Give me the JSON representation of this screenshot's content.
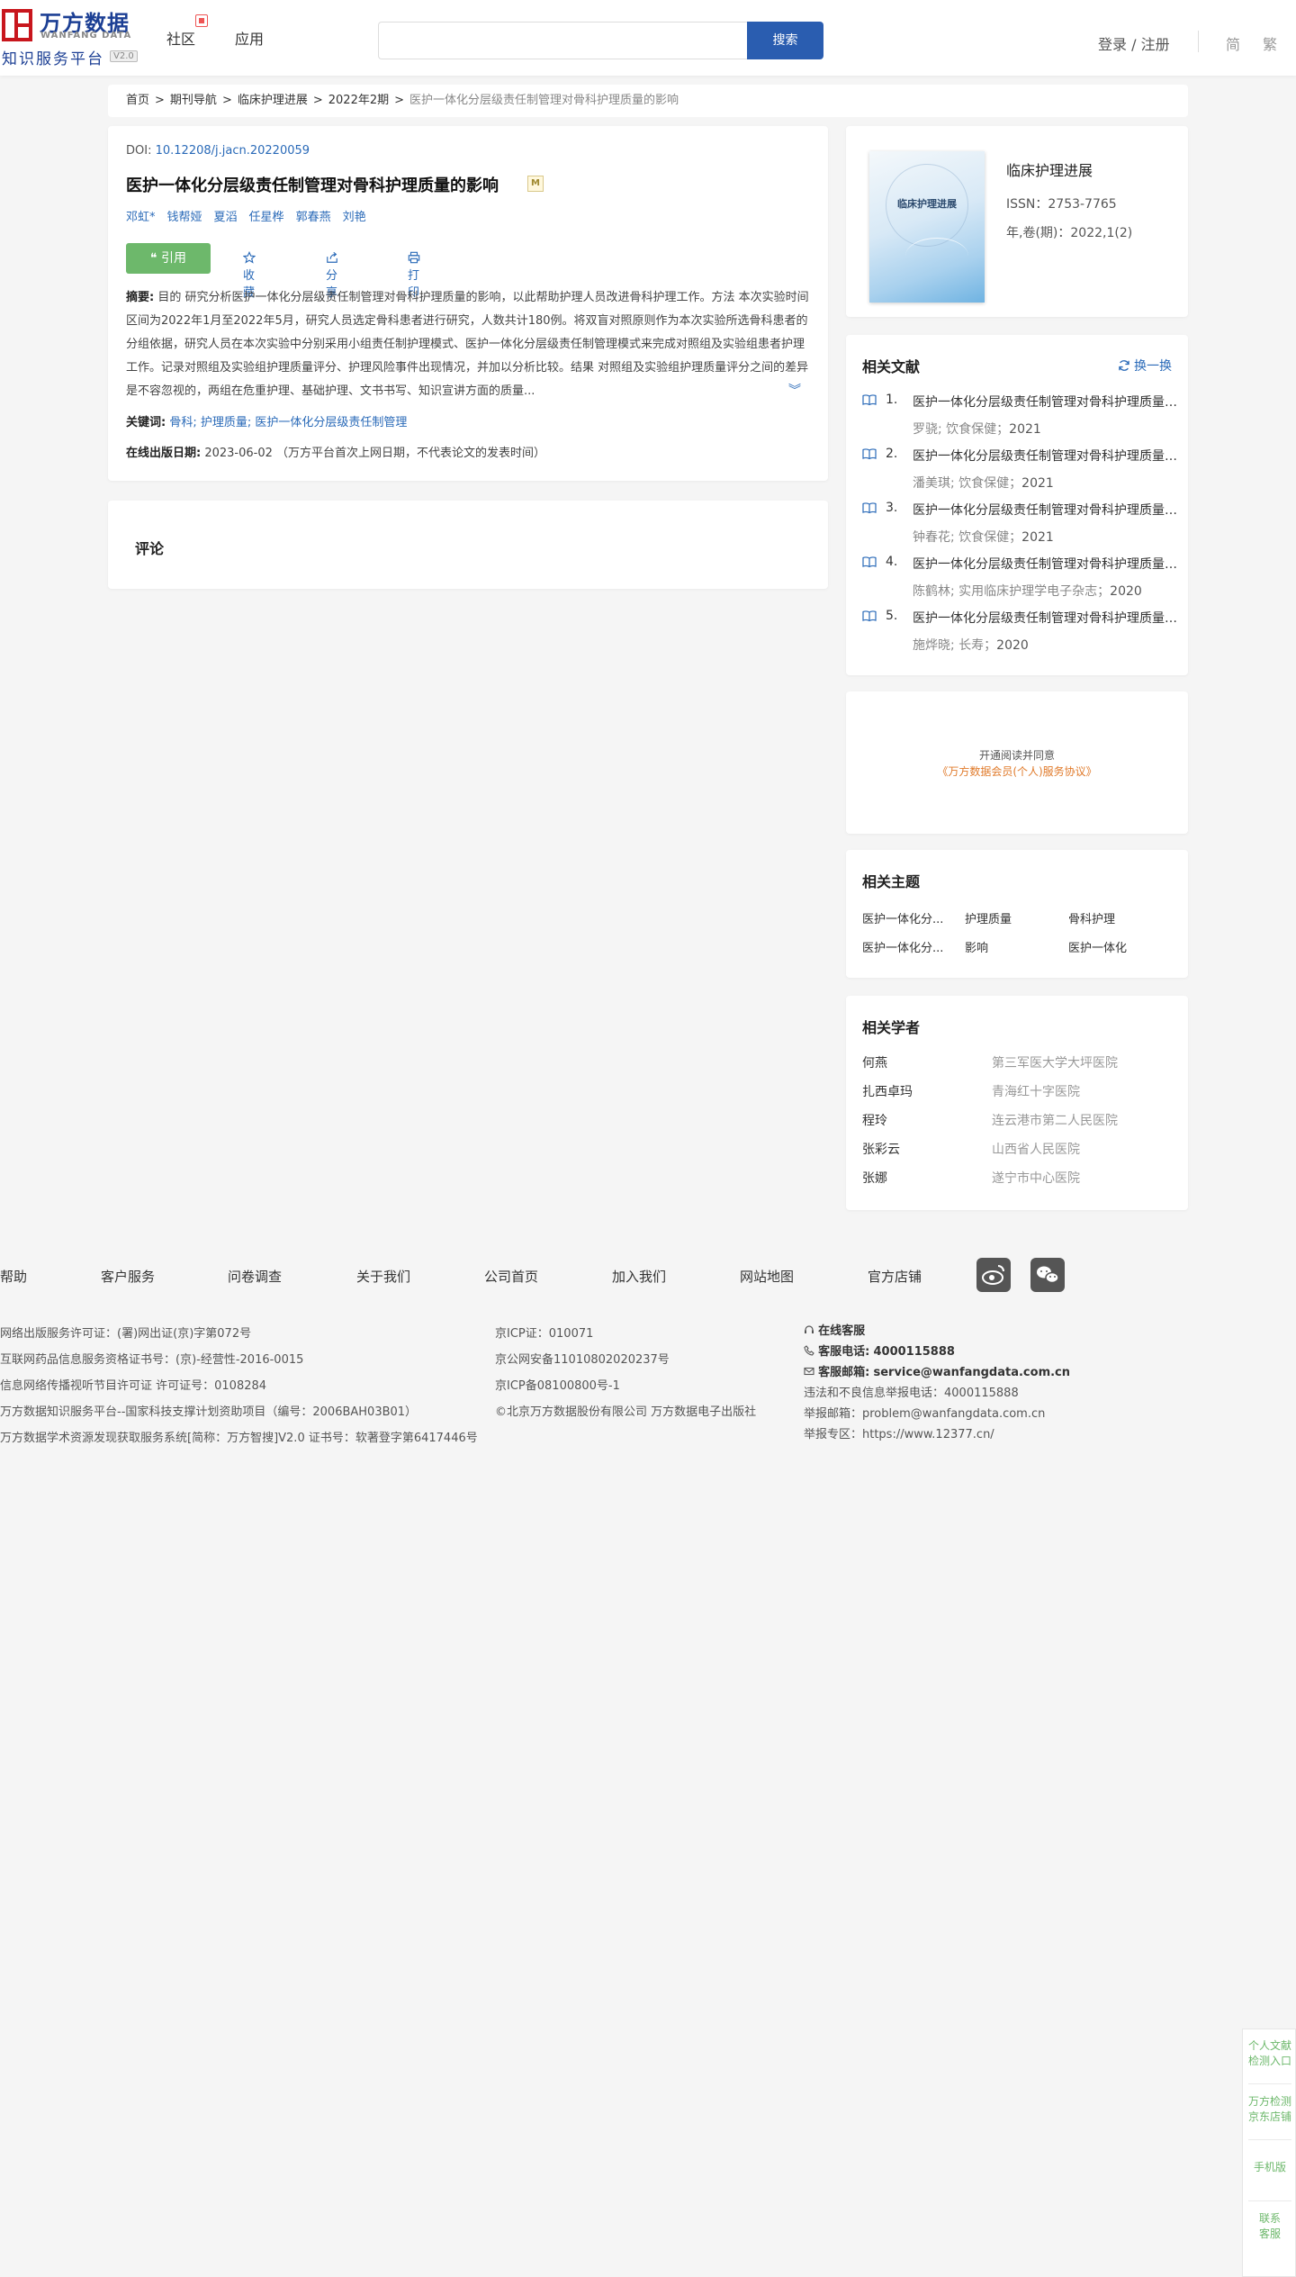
{
  "header": {
    "logo_cn": "万方数据",
    "logo_en": "WANFANG DATA",
    "logo_sub": "知识服务平台",
    "logo_version": "V2.0",
    "nav": [
      "社区",
      "应用"
    ],
    "search_placeholder": "",
    "search_button": "搜索",
    "login": "登录 / 注册",
    "lang_simplified": "简",
    "lang_traditional": "繁"
  },
  "breadcrumb": {
    "items": [
      "首页",
      "期刊导航",
      "临床护理进展",
      "2022年2期"
    ],
    "current": "医护一体化分层级责任制管理对骨科护理质量的影响",
    "separator": ">"
  },
  "article": {
    "doi_label": "DOI:",
    "doi": "10.12208/j.jacn.20220059",
    "title": "医护一体化分层级责任制管理对骨科护理质量的影响",
    "badge": "M",
    "authors": [
      "邓虹*",
      "钱帮娅",
      "夏滔",
      "任星桦",
      "郭春燕",
      "刘艳"
    ],
    "actions": {
      "cite": "❝ 引用",
      "favorite": "收藏",
      "share": "分享",
      "print": "打印"
    },
    "abstract_label": "摘要:",
    "abstract": "目的 研究分析医护一体化分层级责任制管理对骨科护理质量的影响，以此帮助护理人员改进骨科护理工作。方法 本次实验时间区间为2022年1月至2022年5月，研究人员选定骨科患者进行研究，人数共计180例。将双盲对照原则作为本次实验所选骨科患者的分组依据，研究人员在本次实验中分别采用小组责任制护理模式、医护一体化分层级责任制管理模式来完成对照组及实验组患者护理工作。记录对照组及实验组护理质量评分、护理风险事件出现情况，并加以分析比较。结果 对照组及实验组护理质量评分之间的差异是不容忽视的，两组在危重护理、基础护理、文书书写、知识宣讲方面的质量...",
    "expand": "︾",
    "keywords_label": "关键词:",
    "keywords": [
      "骨科",
      "护理质量",
      "医护一体化分层级责任制管理"
    ],
    "pubdate_label": "在线出版日期:",
    "pubdate": "2023-06-02",
    "pubdate_note": "（万方平台首次上网日期，不代表论文的发表时间）"
  },
  "comments": {
    "title": "评论"
  },
  "journal": {
    "cover_title": "临床护理进展",
    "name": "临床护理进展",
    "issn": "ISSN：2753-7765",
    "volume": "年,卷(期)：2022,1(2)"
  },
  "related_docs": {
    "title": "相关文献",
    "refresh": "换一换",
    "items": [
      {
        "num": "1.",
        "title": "医护一体化分层级责任制管理对骨科护理质量的影响",
        "authors": "罗骁; 饮食保健；",
        "year": "2021"
      },
      {
        "num": "2.",
        "title": "医护一体化分层级责任制管理对骨科护理质量的影响",
        "authors": "潘美琪; 饮食保健；",
        "year": "2021"
      },
      {
        "num": "3.",
        "title": "医护一体化分层级责任制管理对骨科护理质量的影响",
        "authors": "钟春花; 饮食保健；",
        "year": "2021"
      },
      {
        "num": "4.",
        "title": "医护一体化分层级责任制管理对骨科护理质量的影响",
        "authors": "陈鹤林; 实用临床护理学电子杂志；",
        "year": "2020"
      },
      {
        "num": "5.",
        "title": "医护一体化分层级责任制管理对骨科护理质量的影响",
        "authors": "施烨晓; 长寿；",
        "year": "2020"
      }
    ]
  },
  "read_notice": {
    "line1": "开通阅读并同意",
    "line2": "《万方数据会员(个人)服务协议》"
  },
  "topics": {
    "title": "相关主题",
    "items": [
      "医护一体化分...",
      "护理质量",
      "骨科护理",
      "医护一体化分...",
      "影响",
      "医护一体化"
    ]
  },
  "scholars": {
    "title": "相关学者",
    "items": [
      {
        "name": "何燕",
        "org": "第三军医大学大坪医院"
      },
      {
        "name": "扎西卓玛",
        "org": "青海红十字医院"
      },
      {
        "name": "程玲",
        "org": "连云港市第二人民医院"
      },
      {
        "name": "张彩云",
        "org": "山西省人民医院"
      },
      {
        "name": "张娜",
        "org": "遂宁市中心医院"
      }
    ]
  },
  "footer": {
    "nav": [
      "帮助",
      "客户服务",
      "问卷调查",
      "关于我们",
      "公司首页",
      "加入我们",
      "网站地图",
      "官方店铺"
    ],
    "col1": [
      "网络出版服务许可证：(署)网出证(京)字第072号",
      "互联网药品信息服务资格证书号：(京)-经营性-2016-0015",
      "信息网络传播视听节目许可证 许可证号：0108284",
      "万方数据知识服务平台--国家科技支撑计划资助项目（编号：2006BAH03B01）",
      "万方数据学术资源发现获取服务系统[简称：万方智搜]V2.0 证书号：软著登字第6417446号"
    ],
    "col2": [
      "京ICP证：010071",
      "京公网安备11010802020237号",
      "京ICP备08100800号-1",
      "©北京万方数据股份有限公司 万方数据电子出版社"
    ],
    "online_service": "在线客服",
    "phone_label": "客服电话:",
    "phone": "4000115888",
    "email_label": "客服邮箱:",
    "email": "service@wanfangdata.com.cn",
    "report_phone": "违法和不良信息举报电话：4000115888",
    "report_email": "举报邮箱：problem@wanfangdata.com.cn",
    "report_zone": "举报专区：https://www.12377.cn/"
  },
  "float_bar": {
    "items": [
      "个人文献\n检测入口",
      "万方检测\n京东店铺",
      "手机版",
      "联系\n客服"
    ]
  },
  "colors": {
    "brand_blue": "#2a5db0",
    "link_blue": "#2a6ab8",
    "cite_green": "#6db86b",
    "logo_red": "#c8161d",
    "notice_orange": "#e07a2a"
  }
}
